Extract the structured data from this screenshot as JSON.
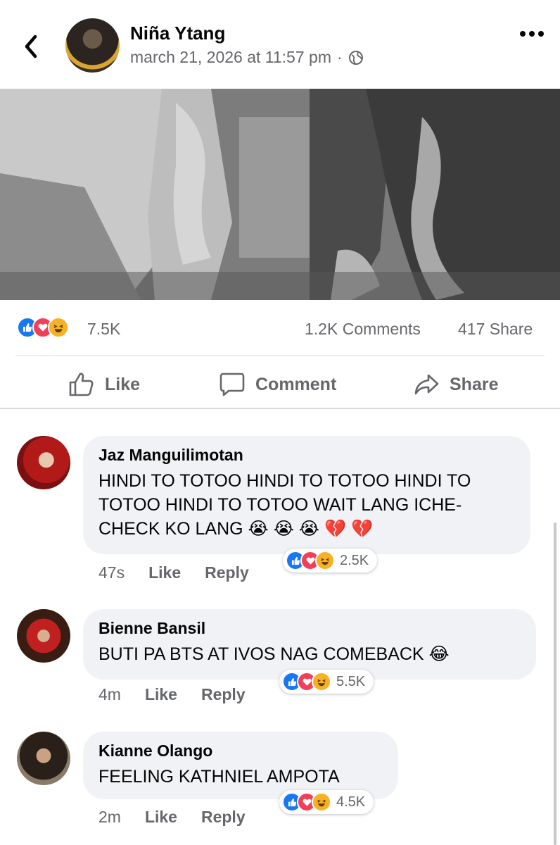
{
  "post": {
    "author": "Niña Ytang",
    "timestamp": "march 21, 2026 at 11:57 pm",
    "separator": "·",
    "privacy_icon": "globe-icon",
    "reactions": {
      "count": "7.5K",
      "types": [
        "like",
        "love",
        "haha"
      ]
    },
    "comments_count": "1.2K Comments",
    "shares_count": "417 Share"
  },
  "actions": {
    "like": "Like",
    "comment": "Comment",
    "share": "Share"
  },
  "comments": [
    {
      "name": "Jaz Manguilimotan",
      "text": "HINDI TO TOTOO HINDI TO TOTOO HINDI TO TOTOO HINDI TO TOTOO WAIT LANG ICHE-CHECK KO LANG 😭 😭 😭 💔 💔",
      "time": "47s",
      "like": "Like",
      "reply": "Reply",
      "reaction_count": "2.5K"
    },
    {
      "name": "Bienne Bansil",
      "text": "BUTI PA BTS AT IVOS NAG COMEBACK 😂",
      "time": "4m",
      "like": "Like",
      "reply": "Reply",
      "reaction_count": "5.5K"
    },
    {
      "name": "Kianne Olango",
      "text": "FEELING KATHNIEL AMPOTA",
      "time": "2m",
      "like": "Like",
      "reply": "Reply",
      "reaction_count": "4.5K"
    }
  ],
  "colors": {
    "accent": "#1877f2",
    "love": "#f33e58",
    "haha": "#f7b125",
    "muted": "#65676b",
    "bubble": "#f0f2f5"
  }
}
